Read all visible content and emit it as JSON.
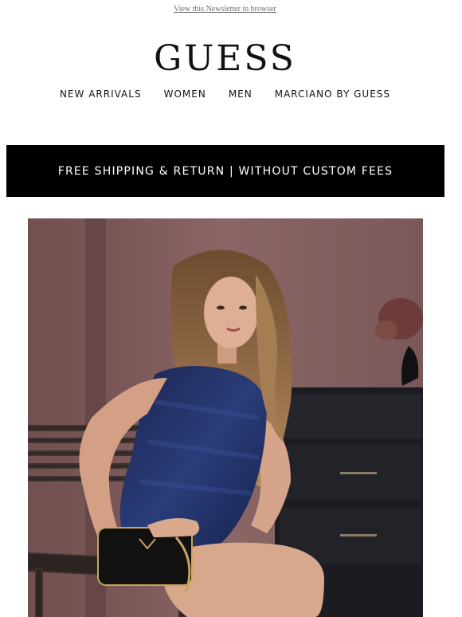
{
  "header": {
    "view_in_browser": "View this Newsletter in browser",
    "logo_text": "GUESS"
  },
  "nav": {
    "items": [
      {
        "label": "NEW ARRIVALS"
      },
      {
        "label": "WOMEN"
      },
      {
        "label": "MEN"
      },
      {
        "label": "MARCIANO BY GUESS"
      }
    ]
  },
  "banner": {
    "text": "FREE SHIPPING & RETURN | WITHOUT CUSTOM FEES"
  },
  "hero": {
    "subject": "model seated in blue sequin dress holding black handbag"
  },
  "colors": {
    "banner_bg": "#000000",
    "banner_text": "#ffffff",
    "link_gray": "#6e6e6e",
    "hero_wall": "#7c5a5a"
  }
}
